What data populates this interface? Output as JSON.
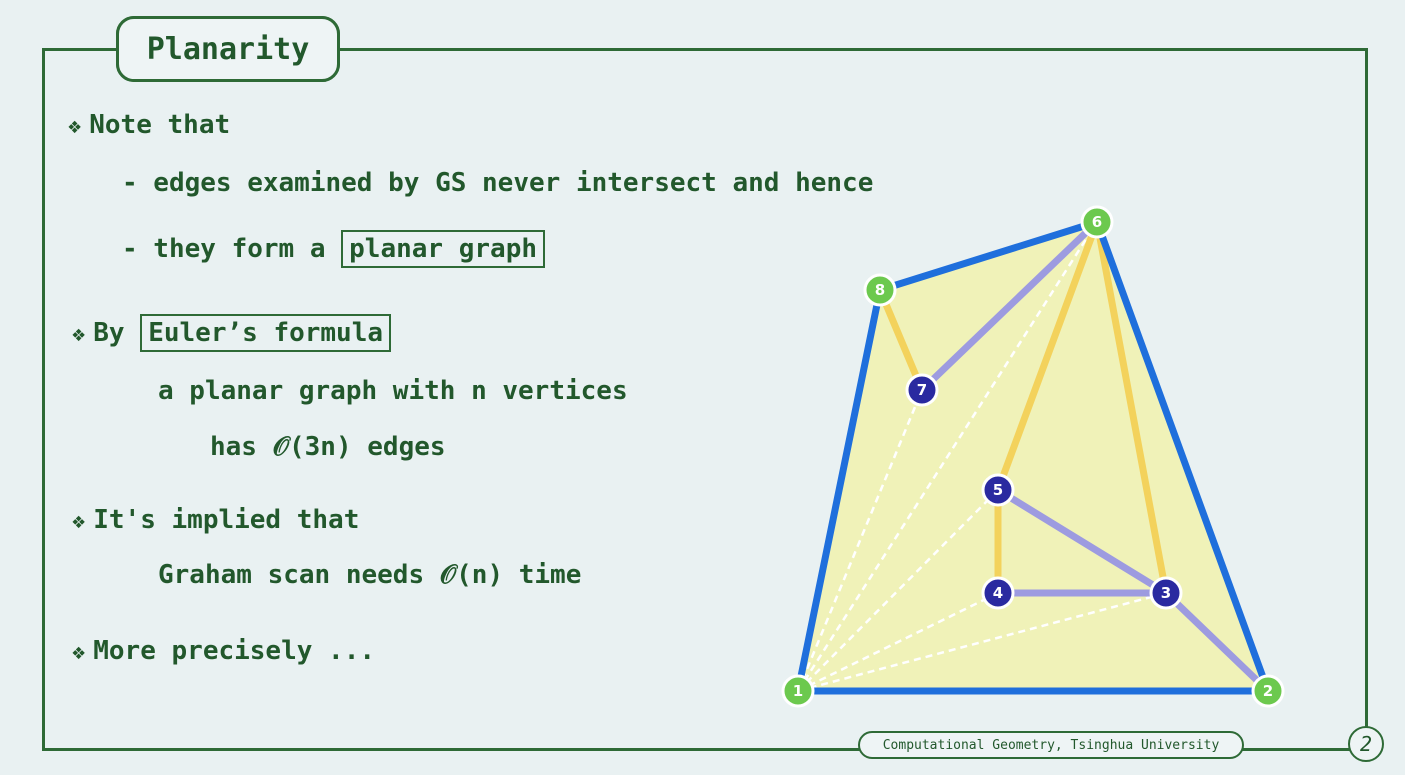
{
  "title": "Planarity",
  "bullets": {
    "b1": "Note that",
    "b1_sub1": "- edges examined by GS never intersect and hence",
    "b1_sub2_prefix": "- they form a",
    "b1_sub2_box": "planar graph",
    "b2_prefix": "By",
    "b2_box": "Euler’s formula",
    "b2_sub1": "a planar graph with n vertices",
    "b2_sub2": "has 𝒪(3n) edges",
    "b3": "It's implied that",
    "b3_sub1": "Graham scan needs 𝒪(n) time",
    "b4": "More precisely ..."
  },
  "bullet_glyph": "❖",
  "footer": "Computational Geometry, Tsinghua University",
  "page_number": "2",
  "graph": {
    "vertices": [
      {
        "id": "1",
        "kind": "hull"
      },
      {
        "id": "2",
        "kind": "hull"
      },
      {
        "id": "3",
        "kind": "inner"
      },
      {
        "id": "4",
        "kind": "inner"
      },
      {
        "id": "5",
        "kind": "inner"
      },
      {
        "id": "6",
        "kind": "hull"
      },
      {
        "id": "7",
        "kind": "inner"
      },
      {
        "id": "8",
        "kind": "hull"
      }
    ],
    "colors": {
      "hull_edge": "#1f6fdc",
      "yellow_edge": "#f3d25c",
      "purple_edge": "#9d9be0",
      "dashed_edge": "#ffffff",
      "fill": "#f0f2b8",
      "hull_vertex": "#6cc94e",
      "inner_vertex": "#2a2aa0"
    }
  }
}
